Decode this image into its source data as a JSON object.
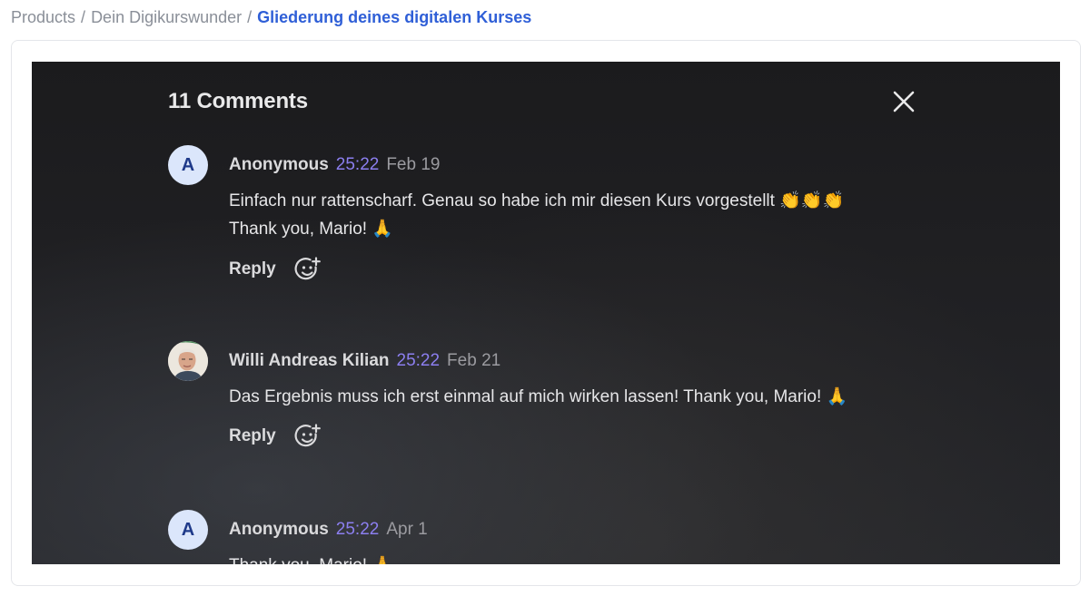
{
  "breadcrumb": {
    "items": [
      "Products",
      "Dein Digikurswunder"
    ],
    "separator": "/",
    "current": "Gliederung deines digitalen Kurses"
  },
  "comments_panel": {
    "title": "11 Comments",
    "reply_label": "Reply",
    "comments": [
      {
        "avatar_letter": "A",
        "author": "Anonymous",
        "timestamp": "25:22",
        "date": "Feb 19",
        "lines": [
          "Einfach nur rattenscharf. Genau so habe ich mir diesen Kurs vorgestellt 👏👏👏",
          "Thank you, Mario! 🙏"
        ]
      },
      {
        "avatar_letter": "",
        "author": "Willi Andreas Kilian",
        "timestamp": "25:22",
        "date": "Feb 21",
        "lines": [
          "Das Ergebnis muss ich erst einmal auf mich wirken lassen!   Thank you, Mario! 🙏"
        ]
      },
      {
        "avatar_letter": "A",
        "author": "Anonymous",
        "timestamp": "25:22",
        "date": "Apr 1",
        "lines": [
          "Thank you, Mario! 🙏"
        ]
      }
    ]
  },
  "colors": {
    "accent_link": "#2f5fd7",
    "timestamp": "#8c7ff0",
    "panel_bg": "#1d1d20"
  }
}
